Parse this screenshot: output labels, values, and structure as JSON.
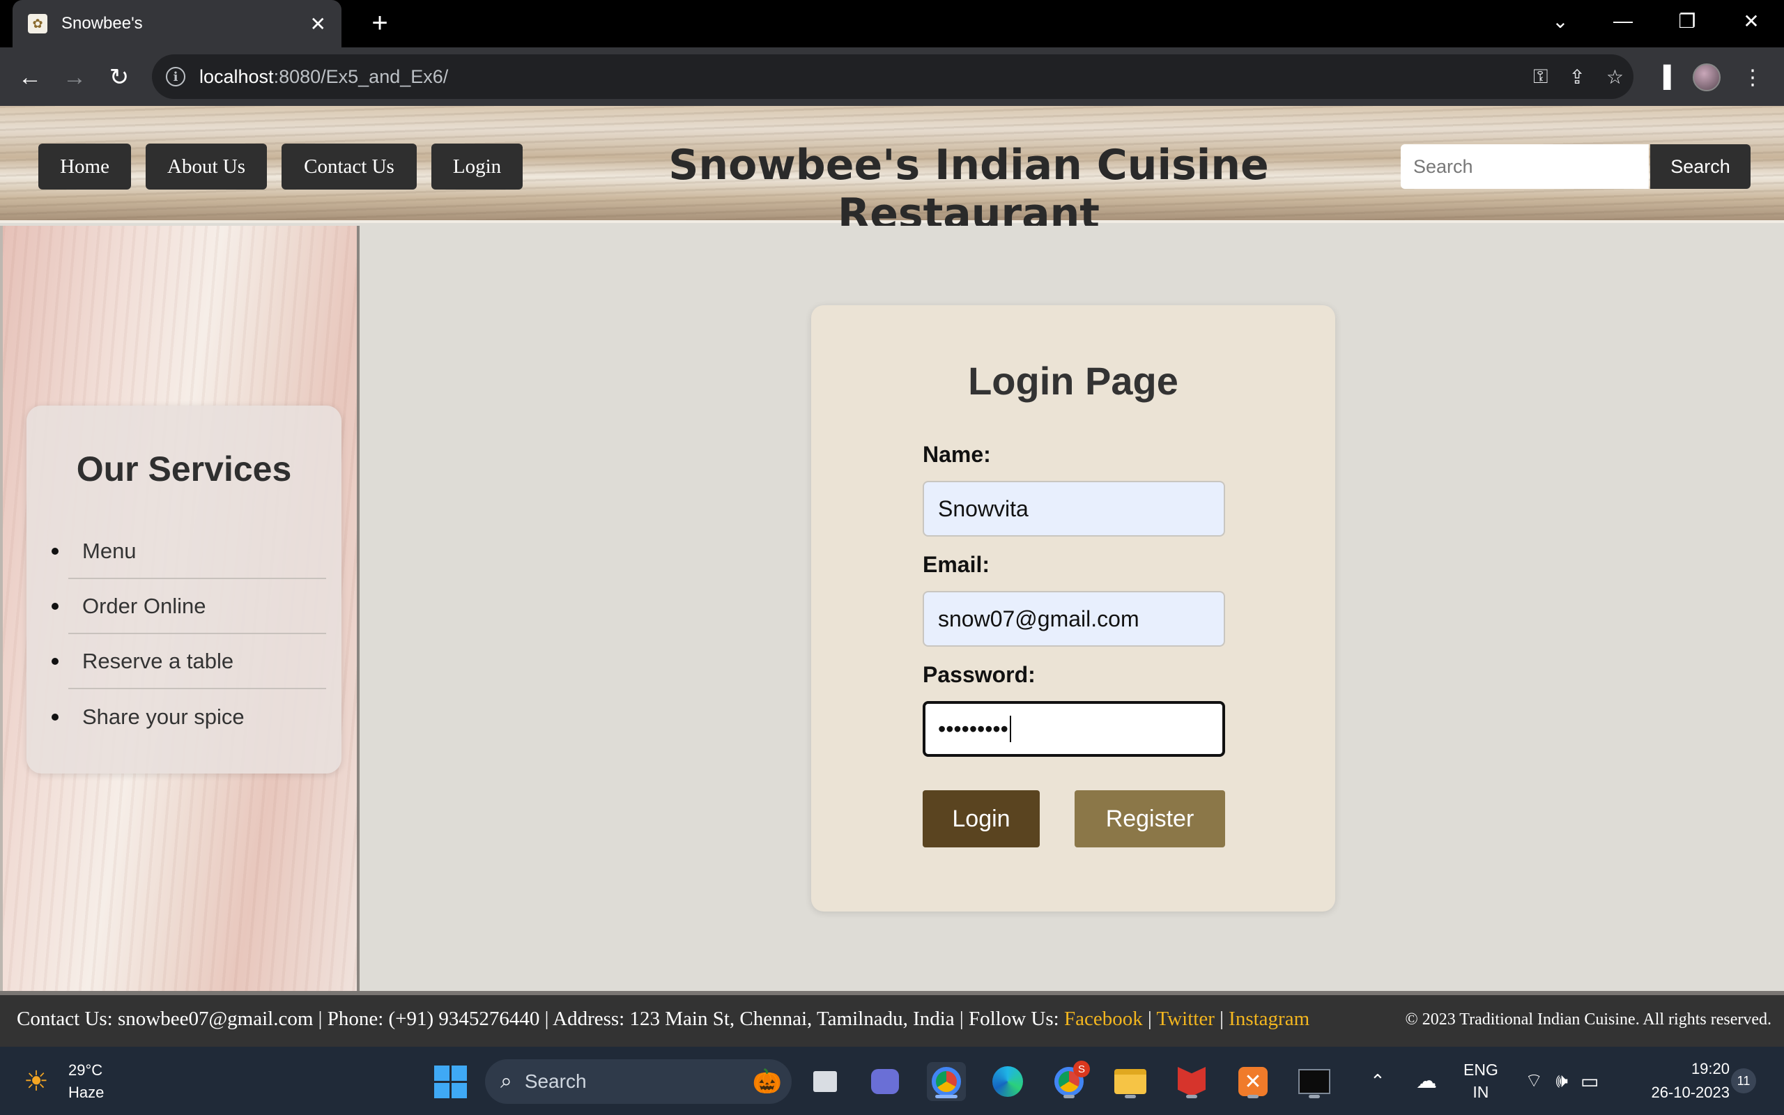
{
  "browser": {
    "tab_title": "Snowbee's",
    "url_host": "localhost",
    "url_path": ":8080/Ex5_and_Ex6/"
  },
  "header": {
    "nav": [
      "Home",
      "About Us",
      "Contact Us",
      "Login"
    ],
    "site_title": "Snowbee's Indian Cuisine Restaurant",
    "search_placeholder": "Search",
    "search_button": "Search"
  },
  "sidebar": {
    "title": "Our Services",
    "items": [
      "Menu",
      "Order Online",
      "Reserve a table",
      "Share your spice"
    ]
  },
  "login": {
    "title": "Login Page",
    "name_label": "Name:",
    "name_value": "Snowvita",
    "email_label": "Email:",
    "email_value": "snow07@gmail.com",
    "password_label": "Password:",
    "password_masked": "•••••••••",
    "login_button": "Login",
    "register_button": "Register",
    "colors": {
      "login_button": "#5a4420",
      "register_button": "#8b7748"
    }
  },
  "footer": {
    "contact_prefix": "Contact Us: snowbee07@gmail.com | Phone: (+91) 9345276440 | Address: 123 Main St, Chennai, Tamilnadu, India | Follow Us: ",
    "links": [
      "Facebook",
      "Twitter",
      "Instagram"
    ],
    "separator": " | ",
    "copyright": "© 2023 Traditional Indian Cuisine. All rights reserved.",
    "link_color": "#f3b61f"
  },
  "taskbar": {
    "weather_temp": "29°C",
    "weather_desc": "Haze",
    "search_label": "Search",
    "lang_top": "ENG",
    "lang_bottom": "IN",
    "time": "19:20",
    "date": "26-10-2023",
    "notification_count": "11",
    "chrome_badge": "S"
  }
}
